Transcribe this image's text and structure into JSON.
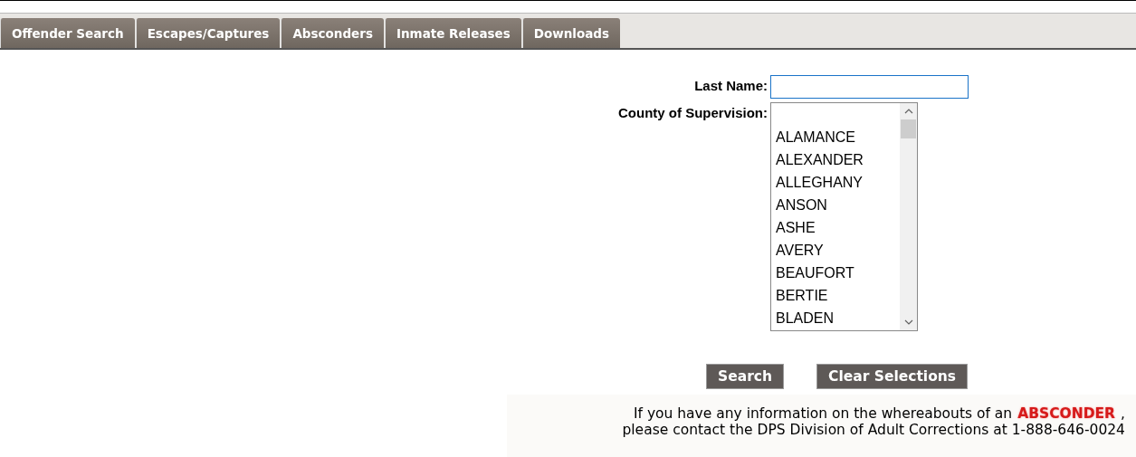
{
  "tabs": [
    {
      "label": "Offender Search"
    },
    {
      "label": "Escapes/Captures"
    },
    {
      "label": "Absconders"
    },
    {
      "label": "Inmate Releases"
    },
    {
      "label": "Downloads"
    }
  ],
  "form": {
    "last_name_label": "Last Name:",
    "county_label": "County of Supervision:",
    "counties": [
      "ALAMANCE",
      "ALEXANDER",
      "ALLEGHANY",
      "ANSON",
      "ASHE",
      "AVERY",
      "BEAUFORT",
      "BERTIE",
      "BLADEN"
    ]
  },
  "buttons": [
    "Search",
    "Clear Selections"
  ],
  "notice": {
    "line_1": "If you have any information on the whereabouts of an",
    "highlight": "ABSCONDER",
    "line_1_end": ",",
    "line_2": "please contact the DPS Division of Adult Corrections at 1-888-646-0024"
  }
}
